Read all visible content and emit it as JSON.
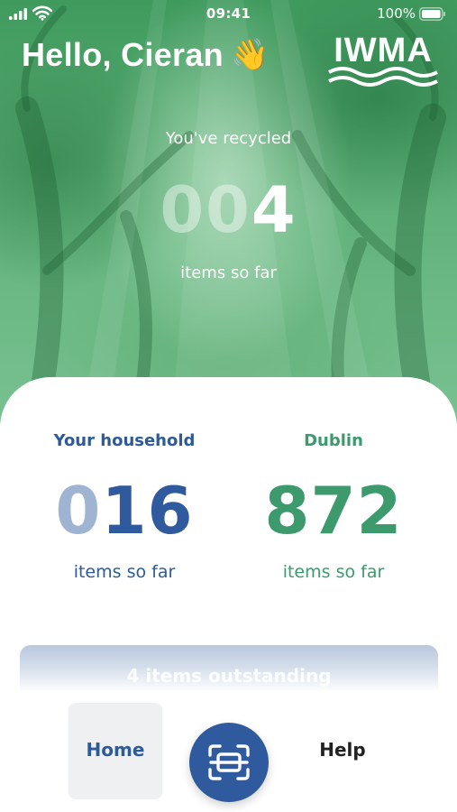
{
  "status_bar": {
    "time": "09:41",
    "battery": "100%",
    "signal_icon": "signal-bars-icon",
    "wifi_icon": "wifi-icon",
    "battery_icon": "battery-full-icon"
  },
  "header": {
    "greeting": "Hello, Cieran",
    "wave_emoji": "👋",
    "logo_text": "IWMA"
  },
  "hero": {
    "label": "You've recycled",
    "count_leading": "00",
    "count_value": "4",
    "items_label": "items so far"
  },
  "stats": {
    "household": {
      "title": "Your household",
      "count_leading": "0",
      "count_value": "16",
      "items_label": "items so far"
    },
    "city": {
      "title": "Dublin",
      "count_value": "872",
      "items_label": "items so far"
    }
  },
  "outstanding": {
    "label": "4 items outstanding"
  },
  "nav": {
    "home_label": "Home",
    "help_label": "Help",
    "scan_icon": "scan-icon"
  },
  "colors": {
    "brand_blue": "#2f5a9e",
    "brand_green": "#3c9a6c",
    "hero_green": "#58ab72"
  }
}
